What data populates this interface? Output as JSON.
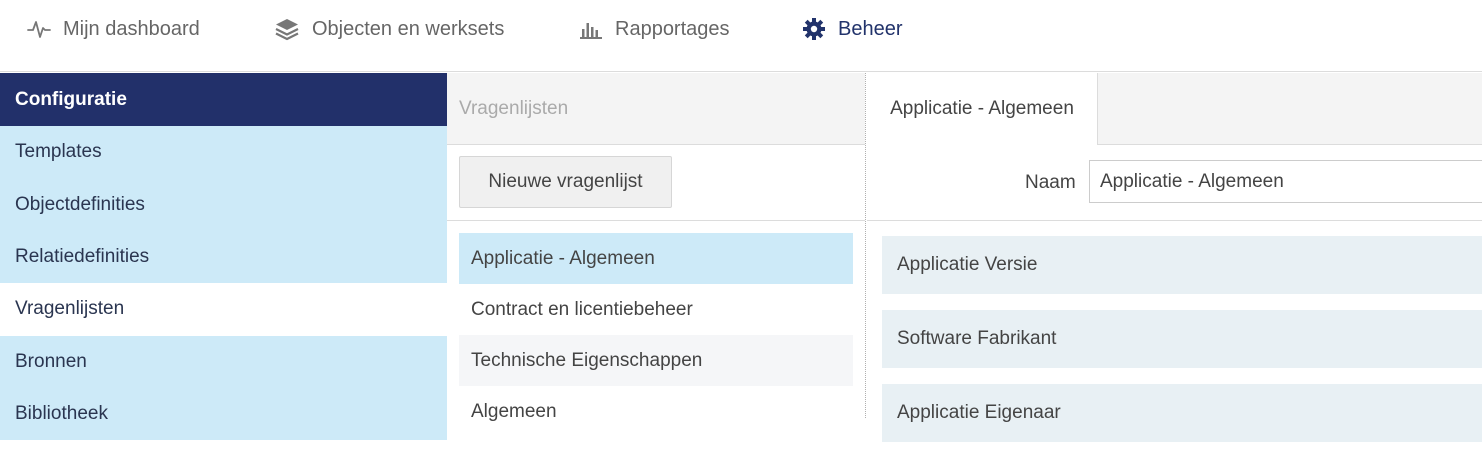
{
  "topnav": {
    "items": [
      {
        "label": "Mijn dashboard",
        "icon": "activity-pulse-icon"
      },
      {
        "label": "Objecten en werksets",
        "icon": "layers-stack-icon"
      },
      {
        "label": "Rapportages",
        "icon": "bar-chart-icon"
      },
      {
        "label": "Beheer",
        "icon": "gear-icon",
        "active": true
      }
    ]
  },
  "sidebar": {
    "header": "Configuratie",
    "items": [
      {
        "label": "Templates"
      },
      {
        "label": "Objectdefinities"
      },
      {
        "label": "Relatiedefinities"
      },
      {
        "label": "Vragenlijsten",
        "selected": true
      },
      {
        "label": "Bronnen"
      },
      {
        "label": "Bibliotheek"
      }
    ]
  },
  "middle": {
    "header": "Vragenlijsten",
    "new_button_label": "Nieuwe vragenlijst",
    "list": [
      {
        "label": "Applicatie - Algemeen",
        "selected": true
      },
      {
        "label": "Contract en licentiebeheer"
      },
      {
        "label": "Technische Eigenschappen"
      },
      {
        "label": "Algemeen"
      }
    ]
  },
  "right": {
    "tab_label": "Applicatie - Algemeen",
    "name_label": "Naam",
    "name_value": "Applicatie - Algemeen",
    "fields": [
      {
        "label": "Applicatie Versie"
      },
      {
        "label": "Software Fabrikant"
      },
      {
        "label": "Applicatie Eigenaar"
      }
    ]
  },
  "colors": {
    "navy": "#22306a",
    "light_blue": "#cdeaf8",
    "field_bg": "#e8f0f4"
  }
}
